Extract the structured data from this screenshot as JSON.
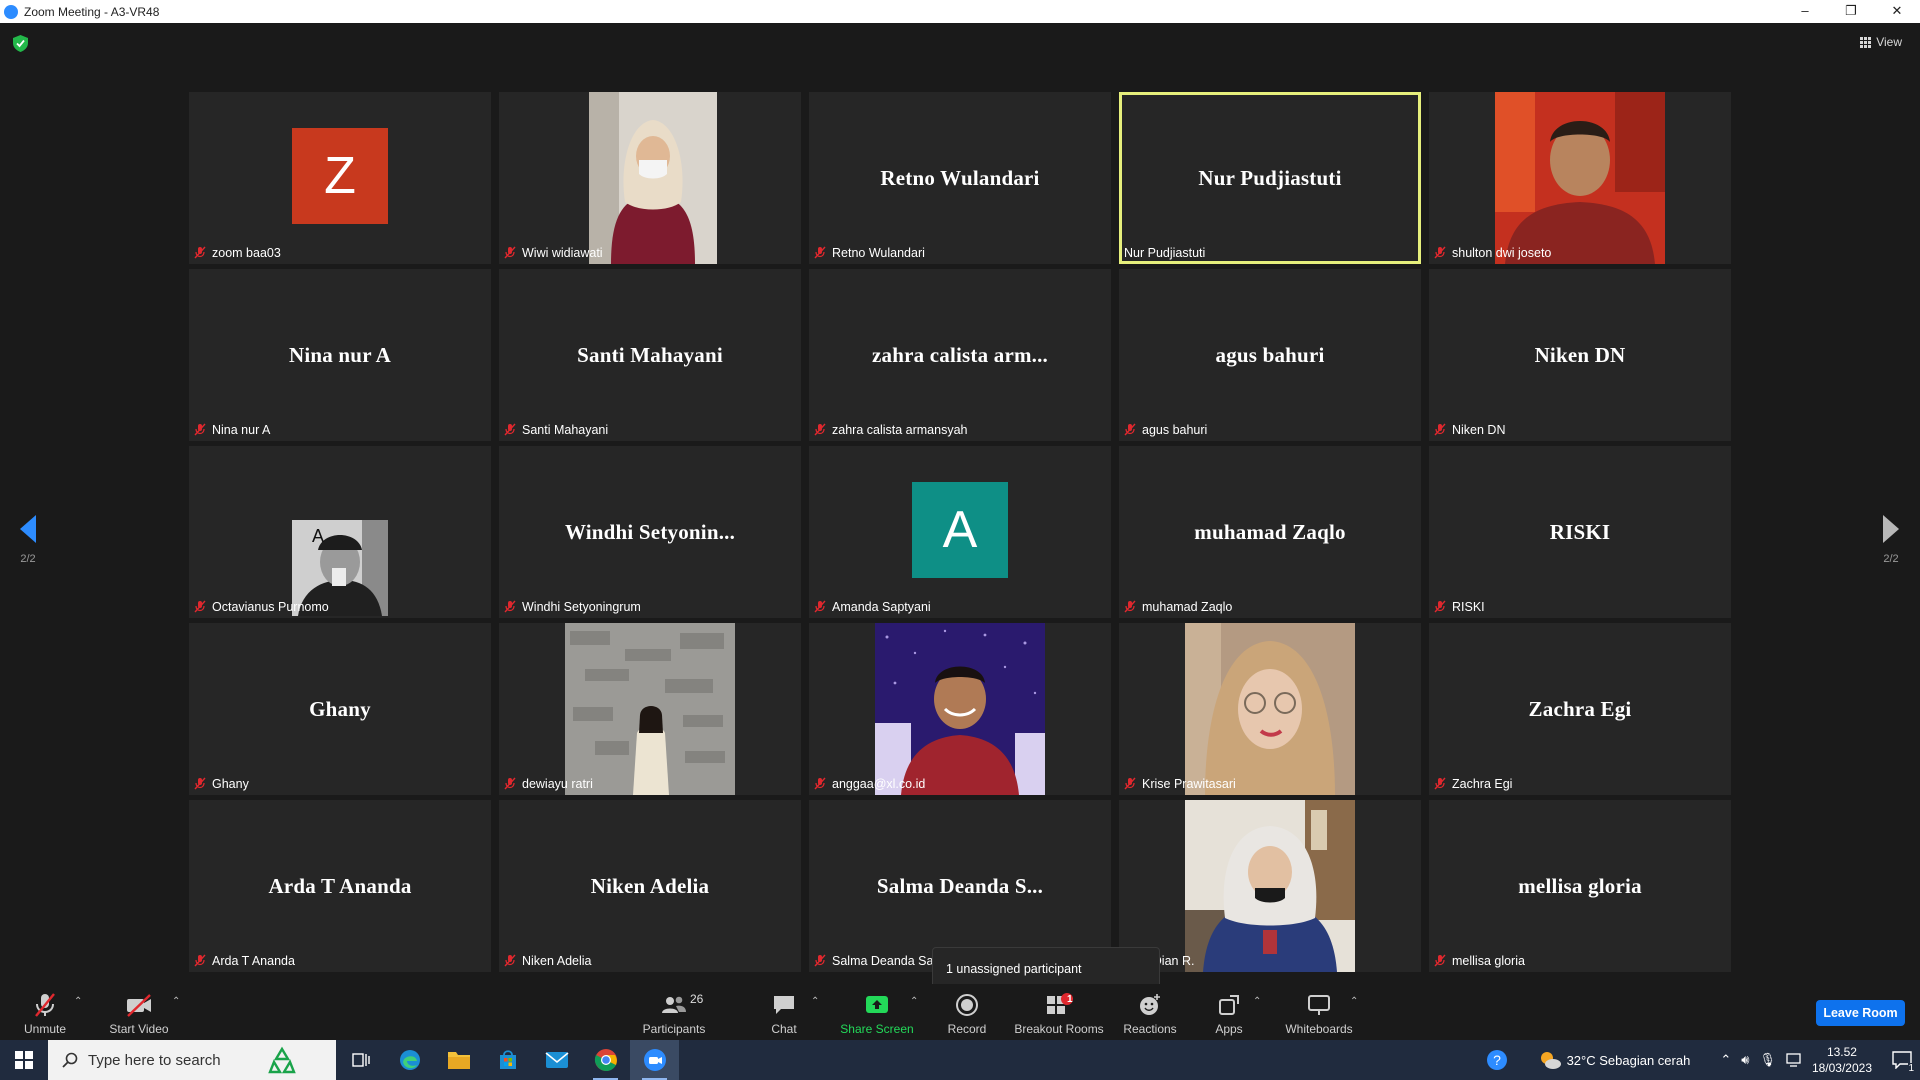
{
  "window": {
    "title": "Zoom Meeting - A3-VR48",
    "minimize": "–",
    "restore": "❐",
    "close": "✕"
  },
  "view_button": {
    "label": "View"
  },
  "pagination": {
    "left": "2/2",
    "right": "2/2"
  },
  "colors": {
    "accent": "#2d8cff",
    "tile_bg": "#262626",
    "active_speaker": "#e6ef7c",
    "avatar_orange": "#c8391e",
    "avatar_teal": "#0e8f86",
    "muted_mic": "#e0282e",
    "share_green": "#23d959",
    "leave_blue": "#0e72ed"
  },
  "participants": [
    {
      "display": "avatar",
      "initial": "Z",
      "avatar_color": "#c8391e",
      "label": "zoom baa03",
      "muted": true
    },
    {
      "display": "photo",
      "photo": "woman-hijab-maroon-shirt-mask",
      "label": "Wiwi widiawati",
      "muted": true
    },
    {
      "display": "name",
      "big_name": "Retno Wulandari",
      "label": "Retno Wulandari",
      "muted": true
    },
    {
      "display": "name",
      "big_name": "Nur Pudjiastuti",
      "label": "Nur Pudjiastuti",
      "muted": false,
      "active": true
    },
    {
      "display": "photo",
      "photo": "man-red-background",
      "label": "shulton dwi joseto",
      "muted": true
    },
    {
      "display": "name",
      "big_name": "Nina nur A",
      "label": "Nina nur A",
      "muted": true
    },
    {
      "display": "name",
      "big_name": "Santi Mahayani",
      "label": "Santi Mahayani",
      "muted": true
    },
    {
      "display": "name",
      "big_name": "zahra calista arm...",
      "label": "zahra calista armansyah",
      "muted": true
    },
    {
      "display": "name",
      "big_name": "agus bahuri",
      "label": "agus bahuri",
      "muted": true
    },
    {
      "display": "name",
      "big_name": "Niken DN",
      "label": "Niken DN",
      "muted": true
    },
    {
      "display": "photo-small",
      "photo": "man-bw-drinking",
      "label": "Octavianus Purnomo",
      "muted": true
    },
    {
      "display": "name",
      "big_name": "Windhi  Setyonin...",
      "label": "Windhi Setyoningrum",
      "muted": true
    },
    {
      "display": "avatar",
      "initial": "A",
      "avatar_color": "#0e8f86",
      "label": "Amanda Saptyani",
      "muted": true
    },
    {
      "display": "name",
      "big_name": "muhamad Zaqlo",
      "label": "muhamad Zaqlo",
      "muted": true
    },
    {
      "display": "name",
      "big_name": "RISKI",
      "label": "RISKI",
      "muted": true
    },
    {
      "display": "name",
      "big_name": "Ghany",
      "label": "Ghany",
      "muted": true
    },
    {
      "display": "photo",
      "photo": "woman-stone-wall",
      "label": "dewiayu ratri",
      "muted": true
    },
    {
      "display": "photo",
      "photo": "man-batik-purple-lights",
      "label": "anggaa@xl.co.id",
      "muted": true
    },
    {
      "display": "photo",
      "photo": "woman-hijab-glasses",
      "label": "Krise Prawitasari",
      "muted": true
    },
    {
      "display": "name",
      "big_name": "Zachra Egi",
      "label": "Zachra Egi",
      "muted": true
    },
    {
      "display": "name",
      "big_name": "Arda T Ananda",
      "label": "Arda T Ananda",
      "muted": true
    },
    {
      "display": "name",
      "big_name": "Niken Adelia",
      "label": "Niken Adelia",
      "muted": true
    },
    {
      "display": "name",
      "big_name": "Salma  Deanda  S...",
      "label": "Salma Deanda Sa",
      "muted": true
    },
    {
      "display": "photo",
      "photo": "woman-hijab-white-scarf",
      "label": "~ Dian R.",
      "muted": true
    },
    {
      "display": "name",
      "big_name": "mellisa gloria",
      "label": "mellisa gloria",
      "muted": true
    }
  ],
  "tooltip": {
    "text": "1 unassigned participant"
  },
  "toolbar": {
    "unmute": "Unmute",
    "start_video": "Start Video",
    "participants": "Participants",
    "participants_count": "26",
    "chat": "Chat",
    "share_screen": "Share Screen",
    "record": "Record",
    "breakout_rooms": "Breakout Rooms",
    "breakout_badge": "1",
    "reactions": "Reactions",
    "apps": "Apps",
    "whiteboards": "Whiteboards",
    "leave": "Leave Room"
  },
  "taskbar": {
    "search_placeholder": "Type here to search",
    "weather": "32°C  Sebagian cerah",
    "time": "13.52",
    "date": "18/03/2023",
    "notification_count": "1"
  }
}
